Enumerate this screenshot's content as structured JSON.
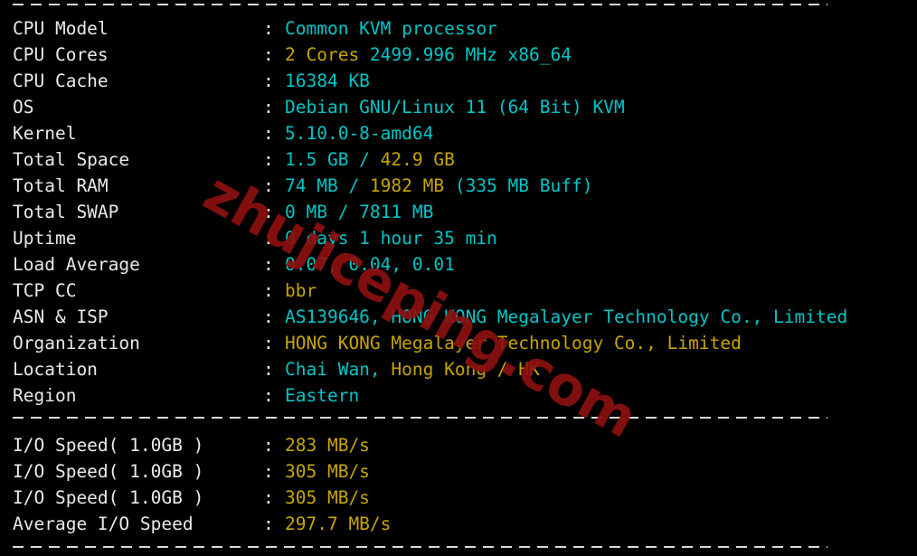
{
  "terminal": {
    "background": "#000000",
    "label_color": "#eaeaea",
    "cyan": "#00c5c7",
    "yellow": "#c7a500",
    "separator": "--------------------------------------------------------------------------",
    "colon": ":"
  },
  "watermark": {
    "text": "zhujiceping.com",
    "color": "#8e1111"
  },
  "system_info": [
    {
      "label": "CPU Model",
      "segments": [
        {
          "text": "Common KVM processor",
          "color": "cyan"
        }
      ]
    },
    {
      "label": "CPU Cores",
      "segments": [
        {
          "text": "2 Cores ",
          "color": "yellow"
        },
        {
          "text": "2499.996 MHz x86_64",
          "color": "cyan"
        }
      ]
    },
    {
      "label": "CPU Cache",
      "segments": [
        {
          "text": "16384 KB",
          "color": "cyan"
        }
      ]
    },
    {
      "label": "OS",
      "segments": [
        {
          "text": "Debian GNU/Linux 11 (64 Bit) KVM",
          "color": "cyan"
        }
      ]
    },
    {
      "label": "Kernel",
      "segments": [
        {
          "text": "5.10.0-8-amd64",
          "color": "cyan"
        }
      ]
    },
    {
      "label": "Total Space",
      "segments": [
        {
          "text": "1.5 GB / ",
          "color": "cyan"
        },
        {
          "text": "42.9 GB",
          "color": "yellow"
        }
      ]
    },
    {
      "label": "Total RAM",
      "segments": [
        {
          "text": "74 MB / ",
          "color": "cyan"
        },
        {
          "text": "1982 MB ",
          "color": "yellow"
        },
        {
          "text": "(335 MB Buff)",
          "color": "cyan"
        }
      ]
    },
    {
      "label": "Total SWAP",
      "segments": [
        {
          "text": "0 MB / 7811 MB",
          "color": "cyan"
        }
      ]
    },
    {
      "label": "Uptime",
      "segments": [
        {
          "text": "0 days 1 hour 35 min",
          "color": "cyan"
        }
      ]
    },
    {
      "label": "Load Average",
      "segments": [
        {
          "text": "0.07, 0.04, 0.01",
          "color": "cyan"
        }
      ]
    },
    {
      "label": "TCP CC",
      "segments": [
        {
          "text": "bbr",
          "color": "yellow"
        }
      ]
    },
    {
      "label": "ASN & ISP",
      "segments": [
        {
          "text": "AS139646, HONG KONG Megalayer Technology Co., Limited",
          "color": "cyan"
        }
      ]
    },
    {
      "label": "Organization",
      "segments": [
        {
          "text": "HONG KONG Megalayer Technology Co., Limited",
          "color": "yellow"
        }
      ]
    },
    {
      "label": "Location",
      "segments": [
        {
          "text": "Chai Wan, ",
          "color": "cyan"
        },
        {
          "text": "Hong Kong / HK",
          "color": "yellow"
        }
      ]
    },
    {
      "label": "Region",
      "segments": [
        {
          "text": "Eastern",
          "color": "cyan"
        }
      ]
    }
  ],
  "io_results": [
    {
      "label": "I/O Speed( 1.0GB )",
      "segments": [
        {
          "text": "283 MB/s",
          "color": "yellow"
        }
      ]
    },
    {
      "label": "I/O Speed( 1.0GB )",
      "segments": [
        {
          "text": "305 MB/s",
          "color": "yellow"
        }
      ]
    },
    {
      "label": "I/O Speed( 1.0GB )",
      "segments": [
        {
          "text": "305 MB/s",
          "color": "yellow"
        }
      ]
    },
    {
      "label": "Average I/O Speed",
      "segments": [
        {
          "text": "297.7 MB/s",
          "color": "yellow"
        }
      ]
    }
  ]
}
